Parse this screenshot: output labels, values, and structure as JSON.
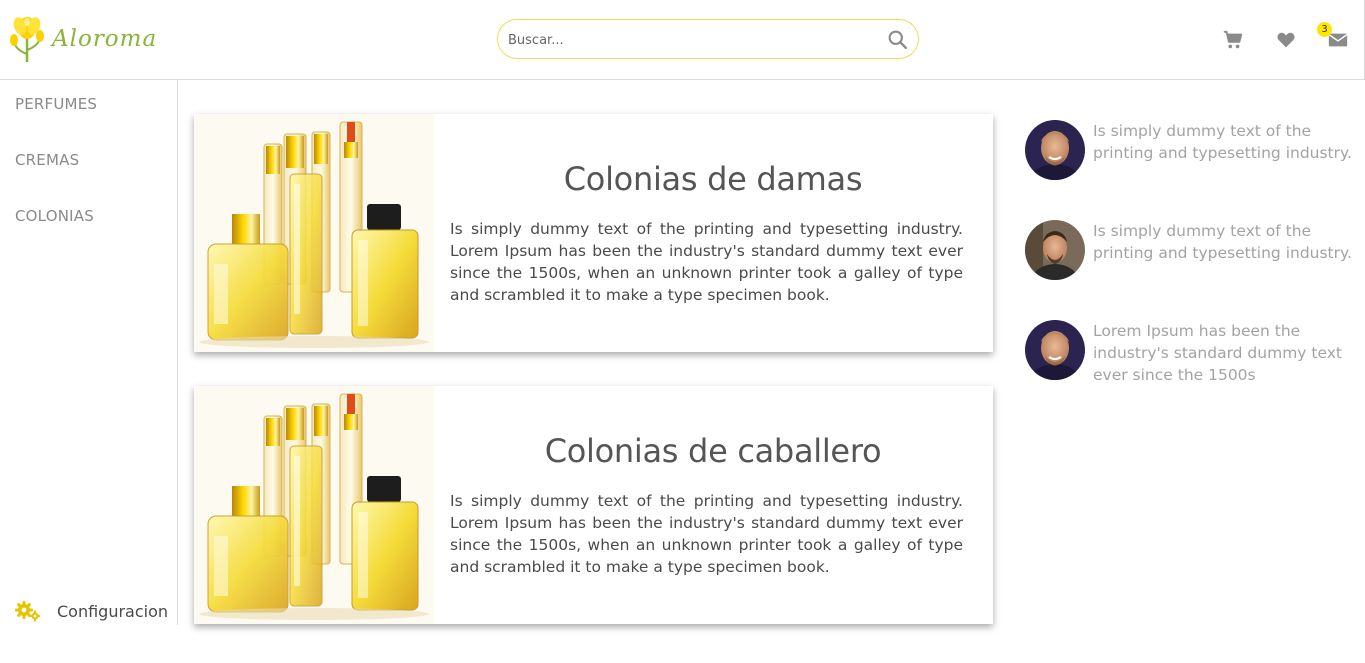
{
  "brand": {
    "name": "Aloroma",
    "color": "#8cb33a",
    "accent": "#ffe600"
  },
  "search": {
    "placeholder": "Buscar..."
  },
  "header": {
    "icons": [
      "cart-icon",
      "heart-icon",
      "mail-icon"
    ],
    "mail_badge": "3"
  },
  "sidebar": {
    "items": [
      {
        "label": "PERFUMES"
      },
      {
        "label": "CREMAS"
      },
      {
        "label": "COLONIAS"
      }
    ],
    "config_label": "Configuracion"
  },
  "cards": [
    {
      "title": "Colonias de damas",
      "description": "Is simply dummy text of the printing and typesetting industry. Lorem Ipsum has been the industry's standard dummy text ever since the 1500s, when an unknown printer took a galley of type and scrambled it to make a type specimen book."
    },
    {
      "title": "Colonias de caballero",
      "description": "Is simply dummy text of the printing and typesetting industry. Lorem Ipsum has been the industry's standard dummy text ever since the 1500s, when an unknown printer took a galley of type and scrambled it to make a type specimen book."
    }
  ],
  "testimonials": [
    {
      "text": "Is simply dummy text of the printing and typesetting industry."
    },
    {
      "text": "Is simply dummy text of the printing and typesetting industry."
    },
    {
      "text": "Lorem Ipsum has been the industry's standard dummy text ever since the 1500s"
    }
  ]
}
